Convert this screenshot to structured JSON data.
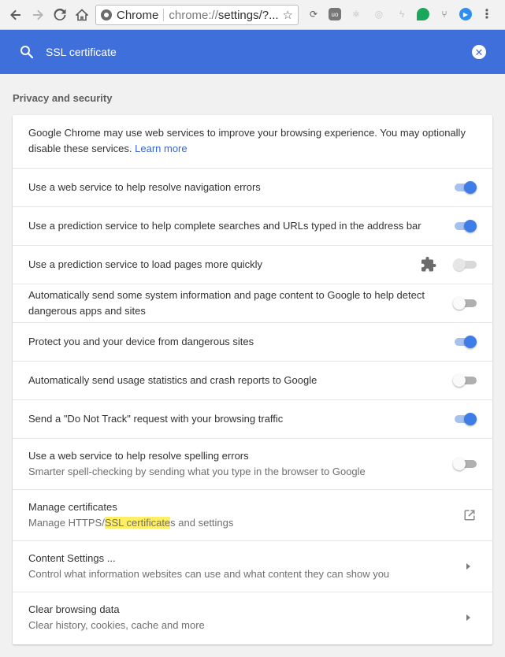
{
  "browser": {
    "omnibox_chip": "Chrome",
    "url_scheme": "chrome://",
    "url_rest": "settings/?..."
  },
  "search": {
    "query": "SSL certificate"
  },
  "section": {
    "title": "Privacy and security"
  },
  "intro": {
    "text": "Google Chrome may use web services to improve your browsing experience. You may optionally disable these services.",
    "link": "Learn more"
  },
  "settings": [
    {
      "label": "Use a web service to help resolve navigation errors",
      "state": "on"
    },
    {
      "label": "Use a prediction service to help complete searches and URLs typed in the address bar",
      "state": "on"
    },
    {
      "label": "Use a prediction service to load pages more quickly",
      "state": "disabled",
      "extension_controlled": true
    },
    {
      "label": "Automatically send some system information and page content to Google to help detect dangerous apps and sites",
      "state": "off"
    },
    {
      "label": "Protect you and your device from dangerous sites",
      "state": "on"
    },
    {
      "label": "Automatically send usage statistics and crash reports to Google",
      "state": "off"
    },
    {
      "label": "Send a \"Do Not Track\" request with your browsing traffic",
      "state": "on"
    },
    {
      "label": "Use a web service to help resolve spelling errors",
      "sub": "Smarter spell-checking by sending what you type in the browser to Google",
      "state": "off"
    }
  ],
  "manage_certificates": {
    "title": "Manage certificates",
    "sub_prefix": "Manage HTTPS/",
    "sub_highlight": "SSL certificate",
    "sub_suffix": "s and settings"
  },
  "content_settings": {
    "title": "Content Settings ...",
    "sub": "Control what information websites can use and what content they can show you"
  },
  "clear_browsing": {
    "title": "Clear browsing data",
    "sub": "Clear history, cookies, cache and more"
  }
}
